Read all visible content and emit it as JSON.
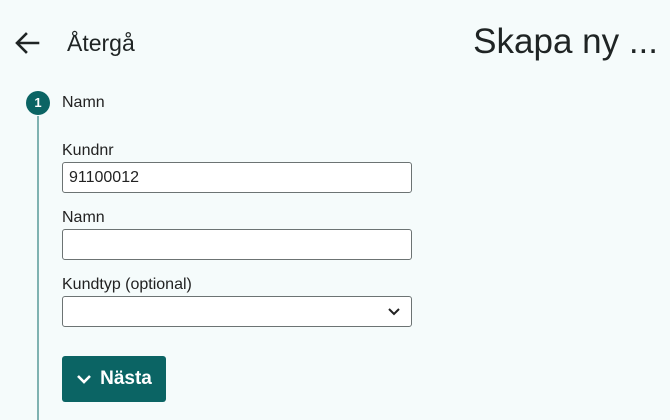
{
  "header": {
    "back_label": "Återgå",
    "page_title": "Skapa ny ...",
    "back_icon": "arrow-left-icon"
  },
  "stepper": {
    "step_number": "1",
    "step_label": "Namn"
  },
  "form": {
    "customer_number": {
      "label": "Kundnr",
      "value": "91100012"
    },
    "name": {
      "label": "Namn",
      "value": ""
    },
    "customer_type": {
      "label": "Kundtyp (optional)",
      "selected": ""
    }
  },
  "actions": {
    "next_label": "Nästa",
    "next_icon": "chevron-down-icon"
  },
  "colors": {
    "accent": "#0b6464",
    "background": "#f5fbfb",
    "rail": "#7fb2b1"
  }
}
